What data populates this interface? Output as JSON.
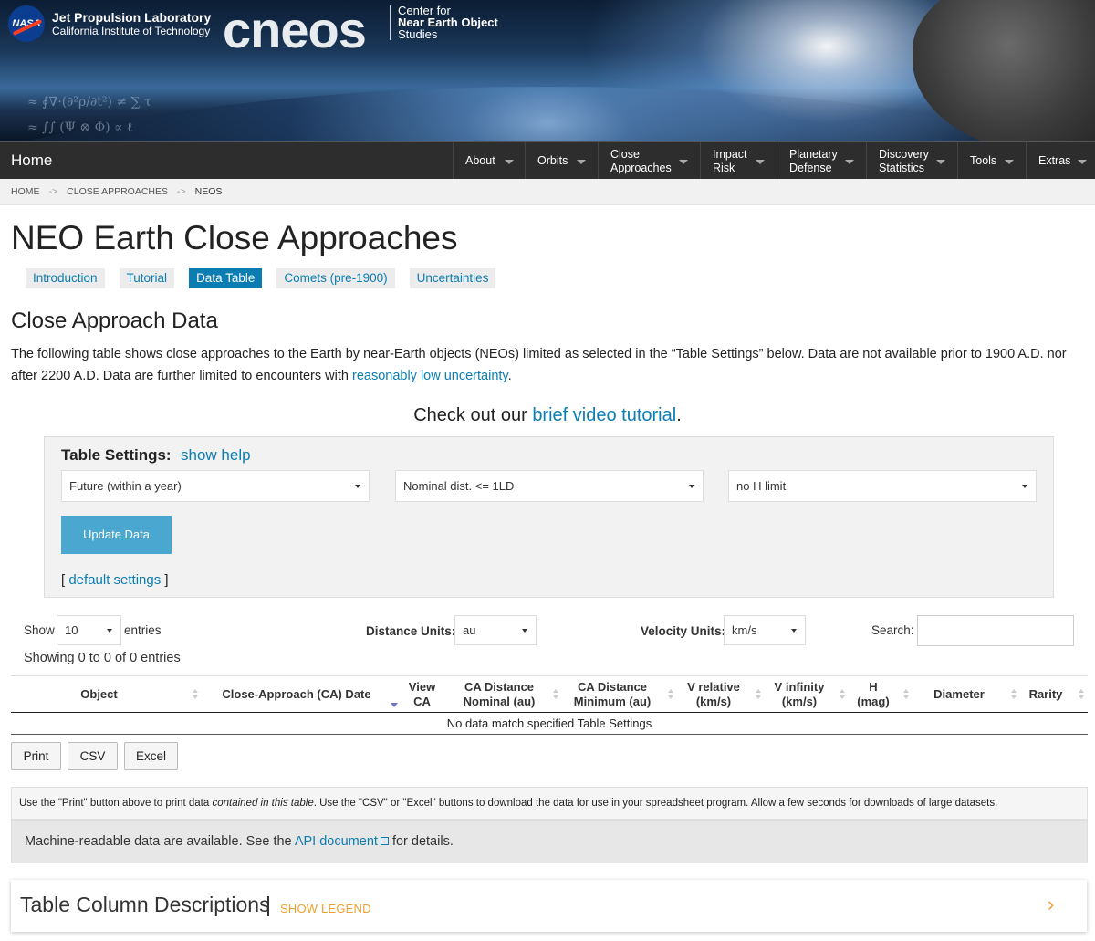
{
  "header": {
    "org_name": "Jet Propulsion Laboratory",
    "org_sub": "California Institute of Technology",
    "nasa_label": "NASA",
    "brand": "cneos",
    "brand_line1": "Center for",
    "brand_line2": "Near Earth Object",
    "brand_line3": "Studies"
  },
  "nav": {
    "home": "Home",
    "items": [
      {
        "line1": "About",
        "line2": ""
      },
      {
        "line1": "Orbits",
        "line2": ""
      },
      {
        "line1": "Close",
        "line2": "Approaches"
      },
      {
        "line1": "Impact",
        "line2": "Risk"
      },
      {
        "line1": "Planetary",
        "line2": "Defense"
      },
      {
        "line1": "Discovery",
        "line2": "Statistics"
      },
      {
        "line1": "Tools",
        "line2": ""
      },
      {
        "line1": "Extras",
        "line2": ""
      }
    ]
  },
  "breadcrumb": {
    "items": [
      "HOME",
      "CLOSE APPROACHES",
      "NEOS"
    ],
    "separator": "->"
  },
  "page": {
    "title": "NEO Earth Close Approaches",
    "tabs": [
      "Introduction",
      "Tutorial",
      "Data Table",
      "Comets (pre-1900)",
      "Uncertainties"
    ],
    "active_tab": "Data Table",
    "section_title": "Close Approach Data",
    "intro_part1": "The following table shows close approaches to the Earth by near-Earth objects (NEOs) limited as selected in the “Table Settings” below. Data are not available prior to 1900 A.D. nor after 2200 A.D. Data are further limited to encounters with ",
    "intro_link": "reasonably low uncertainty",
    "intro_end": ".",
    "video_prefix": "Check out our ",
    "video_link": "brief video tutorial",
    "video_end": "."
  },
  "settings": {
    "label": "Table Settings:",
    "help": "show help",
    "time_range": "Future (within a year)",
    "distance": "Nominal dist. <= 1LD",
    "h_limit": "no H limit",
    "update_button": "Update Data",
    "defaults_open": "[ ",
    "defaults_link": "default settings",
    "defaults_close": " ]"
  },
  "controls": {
    "show_label": "Show",
    "entries_value": "10",
    "entries_label": "entries",
    "distance_units_label": "Distance Units:",
    "distance_units_value": "au",
    "velocity_units_label": "Velocity Units:",
    "velocity_units_value": "km/s",
    "search_label": "Search:",
    "search_value": "",
    "showing_text": "Showing 0 to 0 of 0 entries"
  },
  "table": {
    "columns": [
      {
        "line1": "Object",
        "line2": ""
      },
      {
        "line1": "Close-Approach (CA) Date",
        "line2": ""
      },
      {
        "line1": "View",
        "line2": "CA"
      },
      {
        "line1": "CA Distance",
        "line2": "Nominal (au)"
      },
      {
        "line1": "CA Distance",
        "line2": "Minimum (au)"
      },
      {
        "line1": "V relative",
        "line2": "(km/s)"
      },
      {
        "line1": "V infinity",
        "line2": "(km/s)"
      },
      {
        "line1": "H",
        "line2": "(mag)"
      },
      {
        "line1": "Diameter",
        "line2": ""
      },
      {
        "line1": "Rarity",
        "line2": ""
      }
    ],
    "sorted_column": "Close-Approach (CA) Date",
    "empty_message": "No data match specified Table Settings"
  },
  "export": {
    "print": "Print",
    "csv": "CSV",
    "excel": "Excel"
  },
  "notes": {
    "print_part1": "Use the \"Print\" button above to print data ",
    "print_italic": "contained in this table",
    "print_part2": ". Use the \"CSV\" or \"Excel\" buttons to download the data for use in your spreadsheet program. Allow a few seconds for downloads of large datasets.",
    "api_part1": "Machine-readable data are available. See the ",
    "api_link": "API document",
    "api_part2": " for details."
  },
  "legend": {
    "title": "Table Column Descriptions",
    "toggle": "SHOW LEGEND",
    "chevron_icon": "chevron-right-icon"
  },
  "colors": {
    "link": "#0b7db3",
    "nav_bg": "#2d2d2d",
    "button_primary": "#4aa7cf",
    "accent_orange": "#f0a030"
  }
}
